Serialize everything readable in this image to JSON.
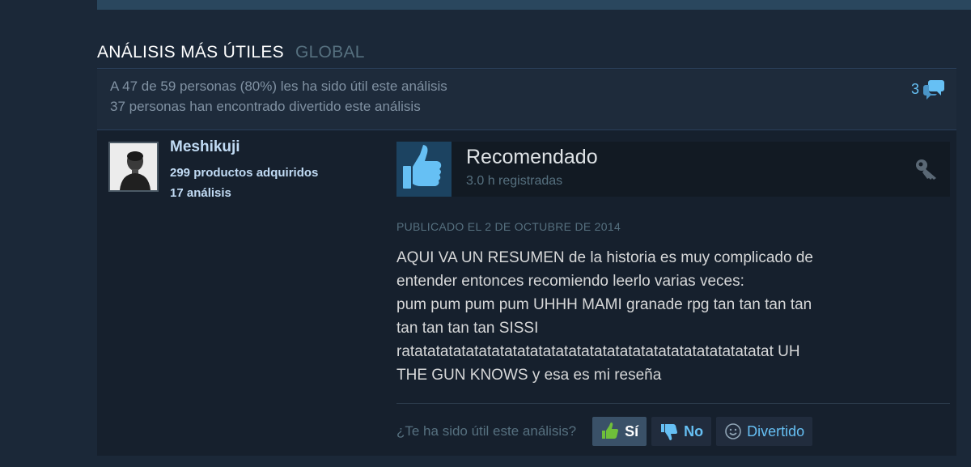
{
  "section": {
    "title": "ANÁLISIS MÁS ÚTILES",
    "subtitle": "GLOBAL"
  },
  "review": {
    "helpful_text": "A 47 de 59 personas (80%) les ha sido útil este análisis",
    "funny_text": "37 personas han encontrado divertido este análisis",
    "comment_count": "3",
    "author": {
      "name": "Meshikuji",
      "products": "299 productos adquiridos",
      "reviews": "17 análisis"
    },
    "verdict": "Recomendado",
    "hours": "3.0 h registradas",
    "posted": "PUBLICADO EL 2 DE OCTUBRE DE 2014",
    "body_lines": [
      "AQUI VA UN RESUMEN de la historia es muy complicado de",
      "entender entonces recomiendo leerlo varias veces:",
      "pum pum pum pum UHHH MAMI granade rpg tan tan tan tan",
      "tan tan tan tan SISSI",
      "ratatatatatatatatatatatatatatatatatatatatatatatatatatatatat UH",
      "THE GUN KNOWS y esa es mi reseña"
    ],
    "feedback": {
      "question": "¿Te ha sido útil este análisis?",
      "yes_label": "Sí",
      "no_label": "No",
      "funny_label": "Divertido"
    }
  },
  "icons": {
    "comment": "speech-bubble-icon",
    "thumb_up": "thumbs-up-icon",
    "key": "key-icon",
    "smiley": "smiley-icon"
  },
  "colors": {
    "background": "#1b2838",
    "accent": "#66c0f4",
    "author_name": "#c1dbf4",
    "muted": "#56707f"
  }
}
